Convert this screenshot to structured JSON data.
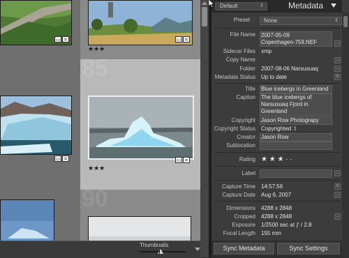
{
  "grid": {
    "cells": [
      {
        "number": "",
        "stars": "★★★",
        "selected": false
      },
      {
        "number": "85",
        "stars": "★★★",
        "selected": true
      },
      {
        "number": "90",
        "stars": "",
        "selected": false
      }
    ]
  },
  "toolbar": {
    "thumbnails_label": "Thumbnails",
    "thumbnail_size": 0.45
  },
  "panel": {
    "preset_name": "Default",
    "title": "Metadata",
    "preset_label": "Preset",
    "preset_value": "None",
    "fields": {
      "file_name_label": "File Name",
      "file_name_line1": "2007-05-09",
      "file_name_line2": "Copenhagen-759.NEF",
      "sidecar_label": "Sidecar Files",
      "sidecar_value": "xmp",
      "copy_name_label": "Copy Name",
      "folder_label": "Folder",
      "folder_value": "2007-08-06 Narsusuaq",
      "metadata_status_label": "Metadata Status",
      "metadata_status_value": "Up to date",
      "title_label": "Title",
      "title_value": "Blue icebergs in Greenland",
      "caption_label": "Caption",
      "caption_line1": "The blue icebergs of",
      "caption_line2": "Narsusuaq Fjord in",
      "caption_line3": "Greenland",
      "copyright_label": "Copyright",
      "copyright_value": "Jason Row Photograpy",
      "copyright_status_label": "Copyright Status",
      "copyright_status_value": "Copyrighted",
      "creator_label": "Creator",
      "creator_value": "Jason Row",
      "sublocation_label": "Sublocation",
      "rating_label": "Rating",
      "rating_value": "★ ★ ★  ·  ·",
      "label_label": "Label",
      "capture_time_label": "Capture Time",
      "capture_time_value": "14:57:56",
      "capture_date_label": "Capture Date",
      "capture_date_value": "Aug 6, 2007",
      "dimensions_label": "Dimensions",
      "dimensions_value": "4288 x 2848",
      "cropped_label": "Cropped",
      "cropped_value": "4288 x 2848",
      "exposure_label": "Exposure",
      "exposure_value": "1/2500 sec at ƒ / 2.8",
      "focal_length_label": "Focal Length",
      "focal_length_value": "155 mm"
    },
    "sync_metadata_label": "Sync Metadata",
    "sync_settings_label": "Sync Settings"
  }
}
